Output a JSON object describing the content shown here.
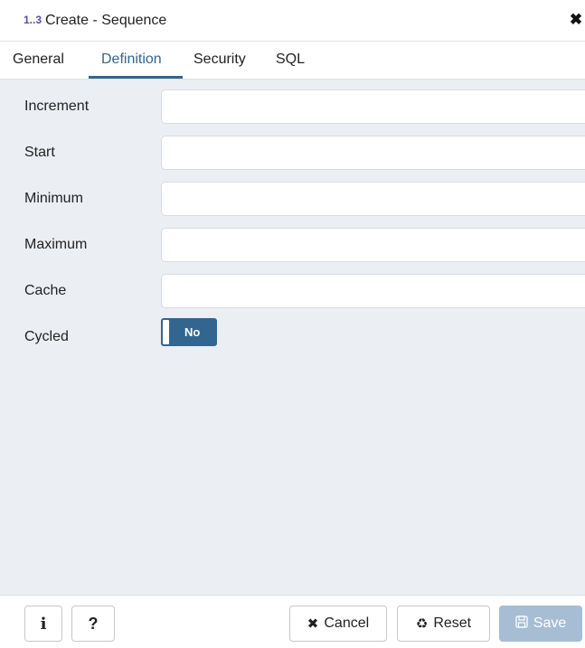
{
  "dialog": {
    "icon": "1..3",
    "title": "Create - Sequence",
    "close_icon": "close-icon"
  },
  "tabs": [
    {
      "label": "General",
      "active": false
    },
    {
      "label": "Definition",
      "active": true
    },
    {
      "label": "Security",
      "active": false
    },
    {
      "label": "SQL",
      "active": false
    }
  ],
  "form": {
    "increment": {
      "label": "Increment",
      "value": ""
    },
    "start": {
      "label": "Start",
      "value": ""
    },
    "minimum": {
      "label": "Minimum",
      "value": ""
    },
    "maximum": {
      "label": "Maximum",
      "value": ""
    },
    "cache": {
      "label": "Cache",
      "value": ""
    },
    "cycled": {
      "label": "Cycled",
      "state": "No"
    }
  },
  "footer": {
    "info_label": "i",
    "help_label": "?",
    "cancel_label": "Cancel",
    "reset_label": "Reset",
    "save_label": "Save"
  },
  "colors": {
    "accent": "#326690",
    "body_bg": "#ebeef3",
    "save_disabled": "#a6bdd3"
  }
}
